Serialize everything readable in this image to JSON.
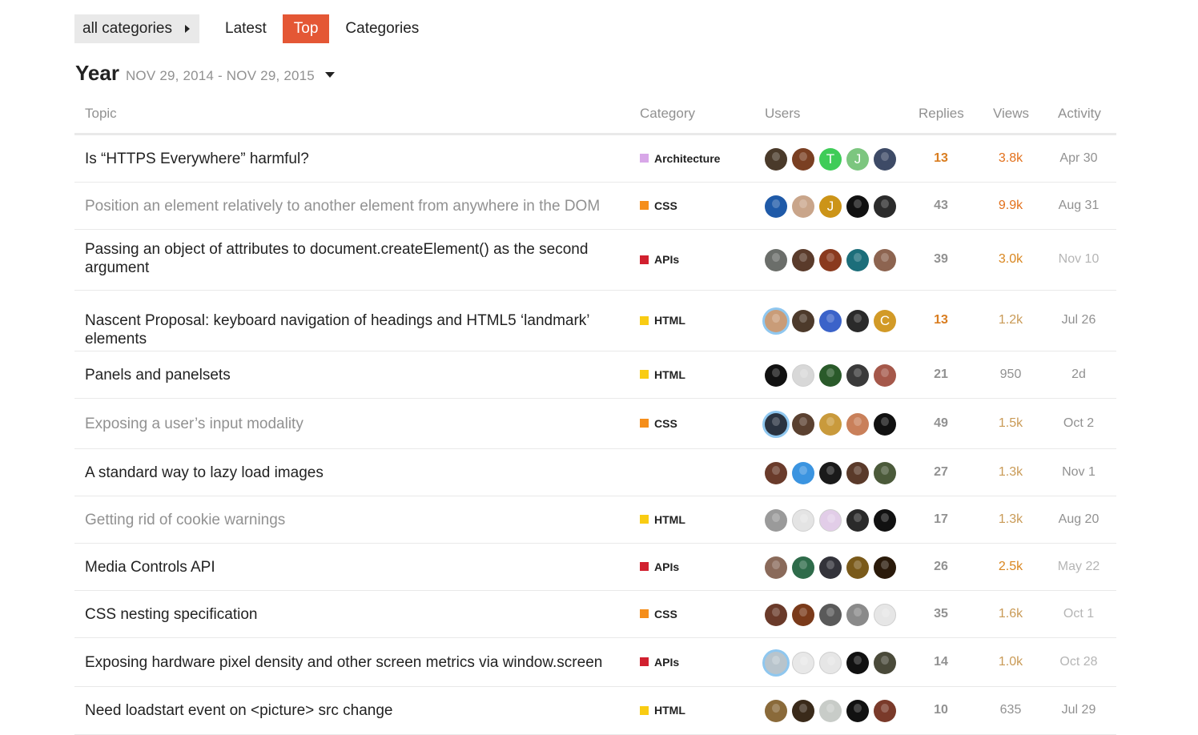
{
  "nav": {
    "category_dropdown": "all categories",
    "latest": "Latest",
    "top": "Top",
    "categories": "Categories",
    "accent_color": "#e45735"
  },
  "period": {
    "label": "Year",
    "range": "NOV 29, 2014 - NOV 29, 2015"
  },
  "columns": {
    "topic": "Topic",
    "category": "Category",
    "users": "Users",
    "replies": "Replies",
    "views": "Views",
    "activity": "Activity"
  },
  "topics": [
    {
      "title": "Is “HTTPS Everywhere” harmful?",
      "visited": false,
      "category": "Architecture",
      "category_color": "#d8a7e8",
      "replies": "13",
      "replies_hot": true,
      "views": "3.8k",
      "views_heat": 2,
      "activity": "Apr 30",
      "activity_old": false,
      "users": [
        {
          "color": "#4a3a2a"
        },
        {
          "color": "#7a3f22"
        },
        {
          "letter": "T",
          "color": "#3fcc58"
        },
        {
          "letter": "J",
          "color": "#7cc67f"
        },
        {
          "color": "#3d4a66"
        }
      ]
    },
    {
      "title": "Position an element relatively to another element from anywhere in the DOM",
      "visited": true,
      "category": "CSS",
      "category_color": "#f58e1b",
      "replies": "43",
      "replies_hot": false,
      "views": "9.9k",
      "views_heat": 2,
      "activity": "Aug 31",
      "activity_old": false,
      "users": [
        {
          "color": "#1f5aa8"
        },
        {
          "color": "#c9a58a"
        },
        {
          "letter": "J",
          "color": "#cc9418"
        },
        {
          "color": "#111111"
        },
        {
          "color": "#2b2b2b"
        }
      ]
    },
    {
      "title": "Passing an object of attributes to document.createElement() as the second argument",
      "visited": false,
      "category": "APIs",
      "category_color": "#d1202f",
      "replies": "39",
      "replies_hot": false,
      "views": "3.0k",
      "views_heat": 1,
      "activity": "Nov 10",
      "activity_old": true,
      "users": [
        {
          "color": "#6b6e6a"
        },
        {
          "color": "#5a3b2b"
        },
        {
          "color": "#8a3a1e"
        },
        {
          "color": "#1c6e7a"
        },
        {
          "color": "#8d6450"
        }
      ]
    },
    {
      "title": "Nascent Proposal: keyboard navigation of headings and HTML5 ‘landmark’ elements",
      "visited": false,
      "category": "HTML",
      "category_color": "#f9cc13",
      "replies": "13",
      "replies_hot": true,
      "views": "1.2k",
      "views_heat": 0,
      "activity": "Jul 26",
      "activity_old": false,
      "users": [
        {
          "color": "#c99c78",
          "ring": true
        },
        {
          "color": "#4d3a2b"
        },
        {
          "color": "#3b63c9"
        },
        {
          "color": "#2a2a2a"
        },
        {
          "letter": "C",
          "color": "#d29a27"
        }
      ]
    },
    {
      "title": "Panels and panelsets",
      "visited": false,
      "category": "HTML",
      "category_color": "#f9cc13",
      "replies": "21",
      "replies_hot": false,
      "views": "950",
      "views_heat": -1,
      "activity": "2d",
      "activity_old": false,
      "users": [
        {
          "color": "#111111"
        },
        {
          "color": "#d8d8d8"
        },
        {
          "color": "#2a5a2a"
        },
        {
          "color": "#3a3a3a"
        },
        {
          "color": "#a5584a"
        }
      ]
    },
    {
      "title": "Exposing a user’s input modality",
      "visited": true,
      "category": "CSS",
      "category_color": "#f58e1b",
      "replies": "49",
      "replies_hot": false,
      "views": "1.5k",
      "views_heat": 0,
      "activity": "Oct 2",
      "activity_old": false,
      "users": [
        {
          "color": "#2a3340",
          "ring": true
        },
        {
          "color": "#5b4130"
        },
        {
          "color": "#c99a3c"
        },
        {
          "color": "#c9805a"
        },
        {
          "color": "#111111"
        }
      ]
    },
    {
      "title": "A standard way to lazy load images",
      "visited": false,
      "category": "",
      "category_color": "",
      "replies": "27",
      "replies_hot": false,
      "views": "1.3k",
      "views_heat": 0,
      "activity": "Nov 1",
      "activity_old": false,
      "users": [
        {
          "color": "#6a3b2b"
        },
        {
          "color": "#3b94e0"
        },
        {
          "color": "#1a1a1a"
        },
        {
          "color": "#5a3a2a"
        },
        {
          "color": "#4b5a3a"
        }
      ]
    },
    {
      "title": "Getting rid of cookie warnings",
      "visited": true,
      "category": "HTML",
      "category_color": "#f9cc13",
      "replies": "17",
      "replies_hot": false,
      "views": "1.3k",
      "views_heat": 0,
      "activity": "Aug 20",
      "activity_old": false,
      "users": [
        {
          "color": "#9a9a9a"
        },
        {
          "color": "#e4e4e4"
        },
        {
          "color": "#e2cde8"
        },
        {
          "color": "#2a2a2a"
        },
        {
          "color": "#111111"
        }
      ]
    },
    {
      "title": "Media Controls API",
      "visited": false,
      "category": "APIs",
      "category_color": "#d1202f",
      "replies": "26",
      "replies_hot": false,
      "views": "2.5k",
      "views_heat": 1,
      "activity": "May 22",
      "activity_old": true,
      "users": [
        {
          "color": "#8a6a5a"
        },
        {
          "color": "#2e6b4a"
        },
        {
          "color": "#33333a"
        },
        {
          "color": "#7a5a1a"
        },
        {
          "color": "#2a1a0a"
        }
      ]
    },
    {
      "title": "CSS nesting specification",
      "visited": false,
      "category": "CSS",
      "category_color": "#f58e1b",
      "replies": "35",
      "replies_hot": false,
      "views": "1.6k",
      "views_heat": 0,
      "activity": "Oct 1",
      "activity_old": true,
      "users": [
        {
          "color": "#6a3a2a"
        },
        {
          "color": "#7a3a1a"
        },
        {
          "color": "#5a5a5a"
        },
        {
          "color": "#8a8a8a"
        },
        {
          "color": "#e6e6e6"
        }
      ]
    },
    {
      "title": "Exposing hardware pixel density and other screen metrics via window.screen",
      "visited": false,
      "category": "APIs",
      "category_color": "#d1202f",
      "replies": "14",
      "replies_hot": false,
      "views": "1.0k",
      "views_heat": 0,
      "activity": "Oct 28",
      "activity_old": true,
      "users": [
        {
          "color": "#b8c4cc",
          "ring": true
        },
        {
          "color": "#e8e8e8"
        },
        {
          "color": "#e6e6e6"
        },
        {
          "color": "#111111"
        },
        {
          "color": "#4a4a3a"
        }
      ]
    },
    {
      "title": "Need loadstart event on <picture> src change",
      "visited": false,
      "category": "HTML",
      "category_color": "#f9cc13",
      "replies": "10",
      "replies_hot": false,
      "views": "635",
      "views_heat": -1,
      "activity": "Jul 29",
      "activity_old": false,
      "users": [
        {
          "color": "#8a6a3a"
        },
        {
          "color": "#3a2a1a"
        },
        {
          "color": "#c8ccc8"
        },
        {
          "color": "#111111"
        },
        {
          "color": "#7a3a2a"
        }
      ]
    }
  ]
}
